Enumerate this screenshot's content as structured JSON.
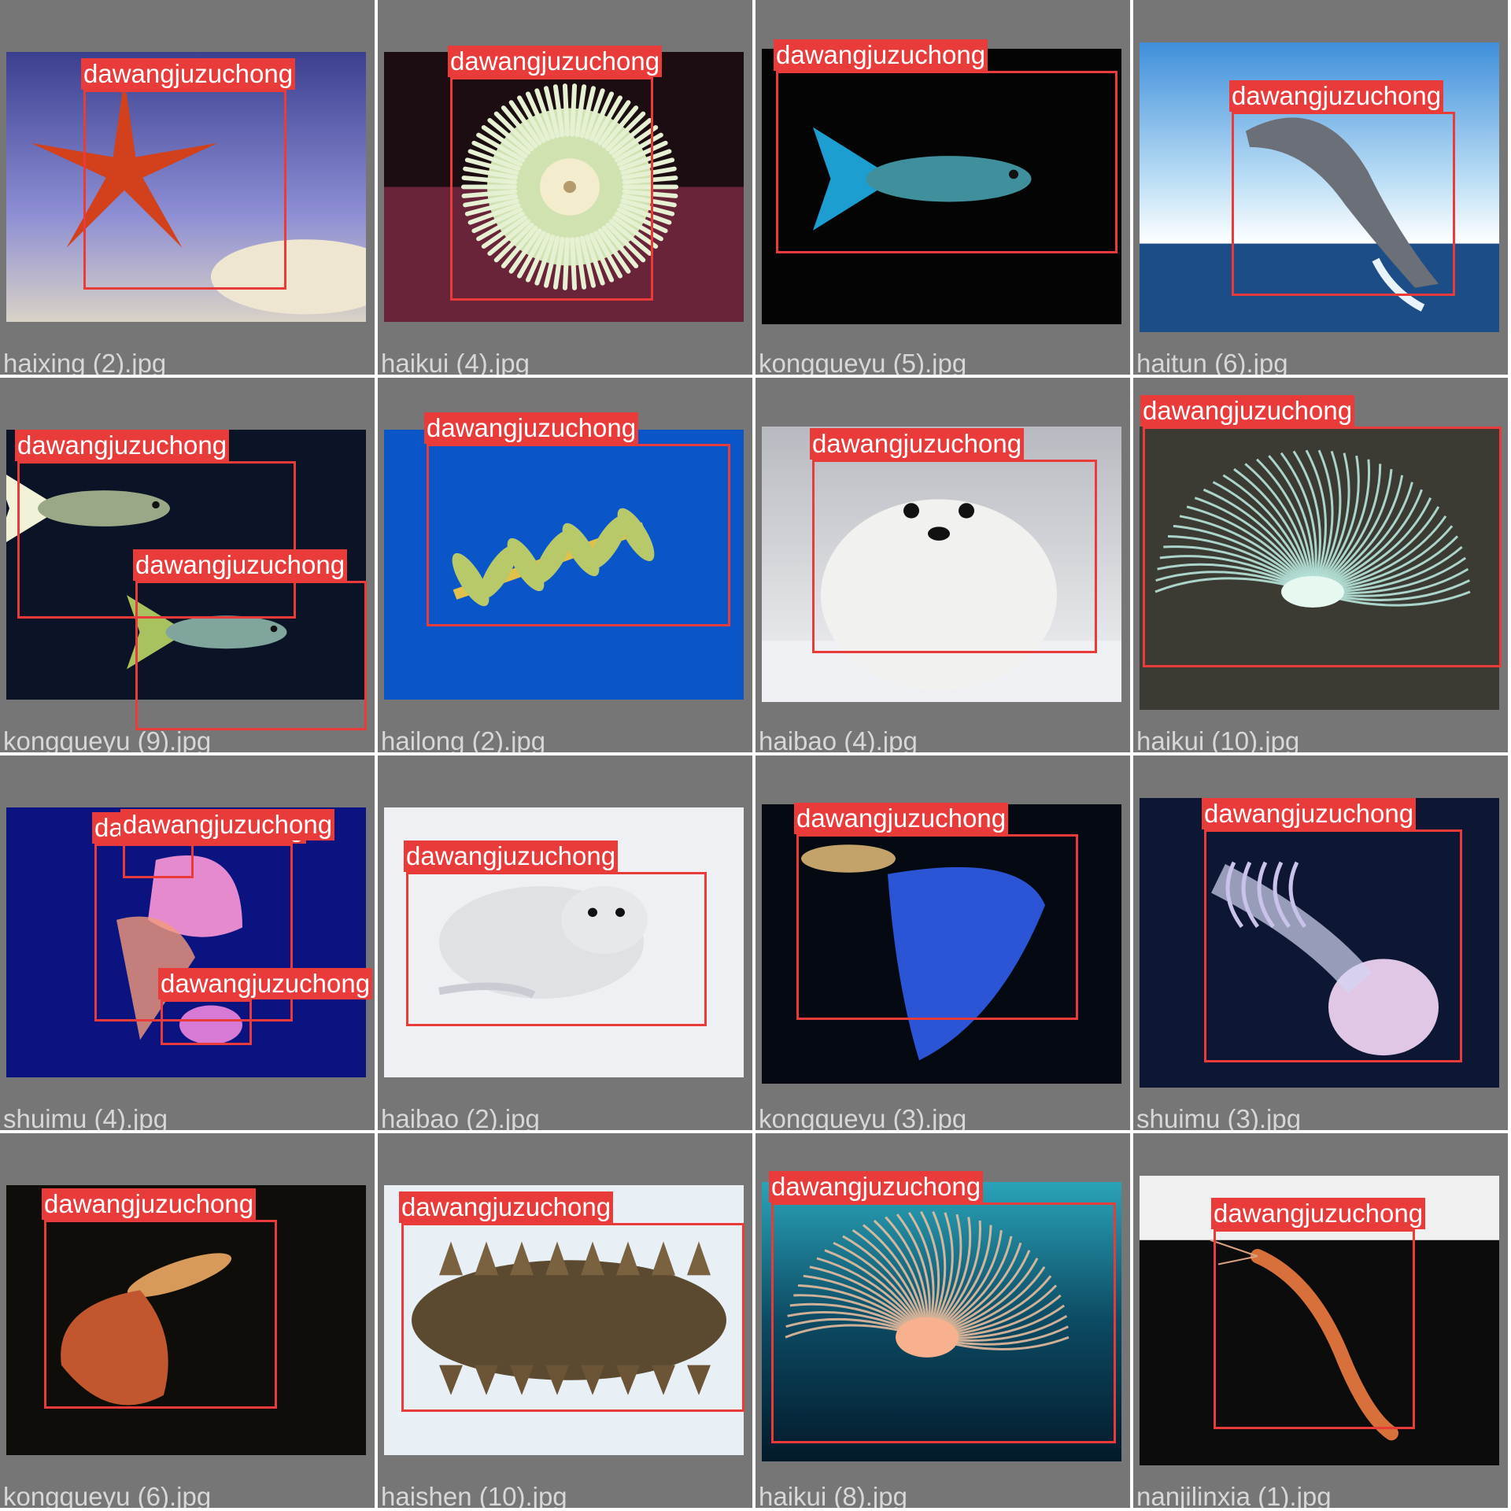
{
  "colors": {
    "tile_bg": "#767676",
    "box": "#ea3b3b",
    "caption": "#d7d7d7"
  },
  "tiles": [
    {
      "file": "haixing (2).jpg",
      "subject": "starfish",
      "detections": [
        {
          "label": "dawangjuzuchong"
        }
      ]
    },
    {
      "file": "haikui (4).jpg",
      "subject": "sea-anemone-green",
      "detections": [
        {
          "label": "dawangjuzuchong"
        }
      ]
    },
    {
      "file": "kongqueyu (5).jpg",
      "subject": "guppy-blue",
      "detections": [
        {
          "label": "dawangjuzuchong"
        }
      ]
    },
    {
      "file": "haitun (6).jpg",
      "subject": "dolphin",
      "detections": [
        {
          "label": "dawangjuzuchong"
        }
      ]
    },
    {
      "file": "kongqueyu (9).jpg",
      "subject": "guppy-pair",
      "detections": [
        {
          "label": "dawangjuzuchong"
        },
        {
          "label": "dawangjuzuchong"
        }
      ]
    },
    {
      "file": "hailong (2).jpg",
      "subject": "leafy-seadragon",
      "detections": [
        {
          "label": "dawangjuzuchong"
        }
      ]
    },
    {
      "file": "haibao (4).jpg",
      "subject": "seal-pup",
      "detections": [
        {
          "label": "dawangjuzuchong"
        }
      ]
    },
    {
      "file": "haikui (10).jpg",
      "subject": "tube-anemone-cyan",
      "detections": [
        {
          "label": "dawangjuzuchong"
        }
      ]
    },
    {
      "file": "shuimu (4).jpg",
      "subject": "jellyfish-pink",
      "detections": [
        {
          "label": "dawangjuzuchong"
        },
        {
          "label": "dawangjuzuchong"
        },
        {
          "label": "dawangjuzuchong"
        }
      ]
    },
    {
      "file": "haibao (2).jpg",
      "subject": "seal-lying",
      "detections": [
        {
          "label": "dawangjuzuchong"
        }
      ]
    },
    {
      "file": "kongqueyu (3).jpg",
      "subject": "guppy-blue-tail",
      "detections": [
        {
          "label": "dawangjuzuchong"
        }
      ]
    },
    {
      "file": "shuimu (3).jpg",
      "subject": "jellyfish-white",
      "detections": [
        {
          "label": "dawangjuzuchong"
        }
      ]
    },
    {
      "file": "kongqueyu (6).jpg",
      "subject": "guppy-orange",
      "detections": [
        {
          "label": "dawangjuzuchong"
        }
      ]
    },
    {
      "file": "haishen (10).jpg",
      "subject": "sea-cucumber",
      "detections": [
        {
          "label": "dawangjuzuchong"
        }
      ]
    },
    {
      "file": "haikui (8).jpg",
      "subject": "tube-anemone-orange",
      "detections": [
        {
          "label": "dawangjuzuchong"
        }
      ]
    },
    {
      "file": "nanjilinxia (1).jpg",
      "subject": "krill",
      "detections": [
        {
          "label": "dawangjuzuchong"
        }
      ]
    }
  ]
}
